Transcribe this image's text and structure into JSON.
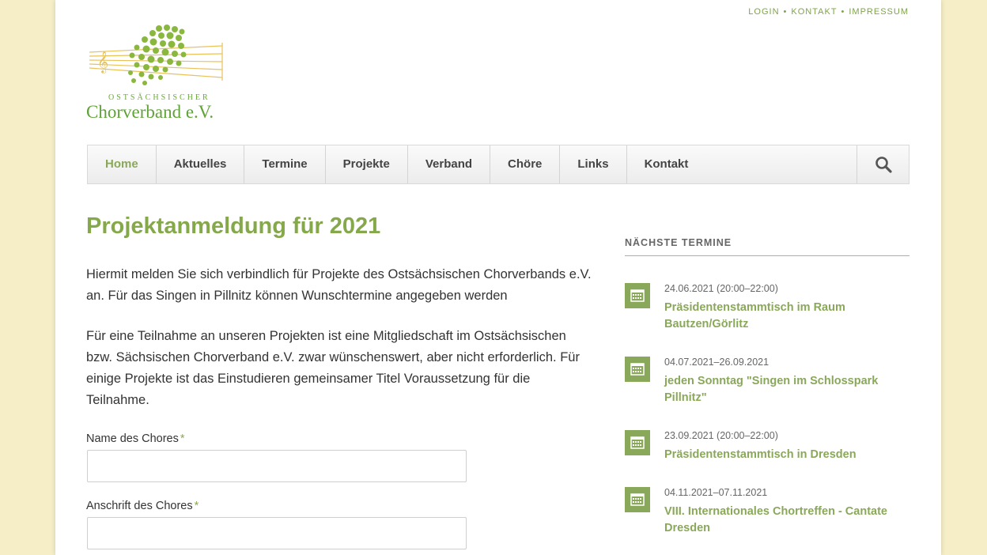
{
  "top_links": [
    "LOGIN",
    "KONTAKT",
    "IMPRESSUM"
  ],
  "top_links_separator": "•",
  "logo": {
    "sub": "OSTSÄCHSISCHER",
    "main": "Chorverband e.V."
  },
  "nav": {
    "items": [
      "Home",
      "Aktuelles",
      "Termine",
      "Projekte",
      "Verband",
      "Chöre",
      "Links",
      "Kontakt"
    ],
    "active": "Home"
  },
  "main": {
    "title": "Projektanmeldung für 2021",
    "paragraphs": [
      "Hiermit melden Sie sich verbindlich für Projekte des Ostsächsischen Chorverbands e.V. an. Für das Singen in Pillnitz können Wunschtermine angegeben werden",
      "Für eine Teilnahme an unseren Projekten ist eine Mitgliedschaft im Ostsächsischen bzw. Sächsischen Chorverband e.V. zwar wünschenswert, aber nicht erforderlich. Für einige Projekte ist das Einstudieren gemeinsamer Titel Voraussetzung für die Teilnahme."
    ],
    "fields": [
      {
        "label": "Name des Chores",
        "required": "*",
        "value": ""
      },
      {
        "label": "Anschrift des Chores",
        "required": "*",
        "value": ""
      }
    ]
  },
  "sidebar": {
    "title": "NÄCHSTE TERMINE",
    "events": [
      {
        "date": "24.06.2021 (20:00–22:00)",
        "name": "Präsidentenstammtisch im Raum Bautzen/Görlitz"
      },
      {
        "date": "04.07.2021–26.09.2021",
        "name": "jeden Sonntag \"Singen im Schlosspark Pillnitz\""
      },
      {
        "date": "23.09.2021 (20:00–22:00)",
        "name": "Präsidentenstammtisch in Dresden"
      },
      {
        "date": "04.11.2021–07.11.2021",
        "name": "VIII. Internationales Chortreffen - Cantate Dresden"
      }
    ]
  },
  "colors": {
    "accent": "#8aa85a",
    "background": "#f5eec6",
    "logo_green": "#6aa83a",
    "logo_yellow": "#e9c25a"
  },
  "icons": {
    "search": "search-icon",
    "event": "calendar-icon"
  }
}
